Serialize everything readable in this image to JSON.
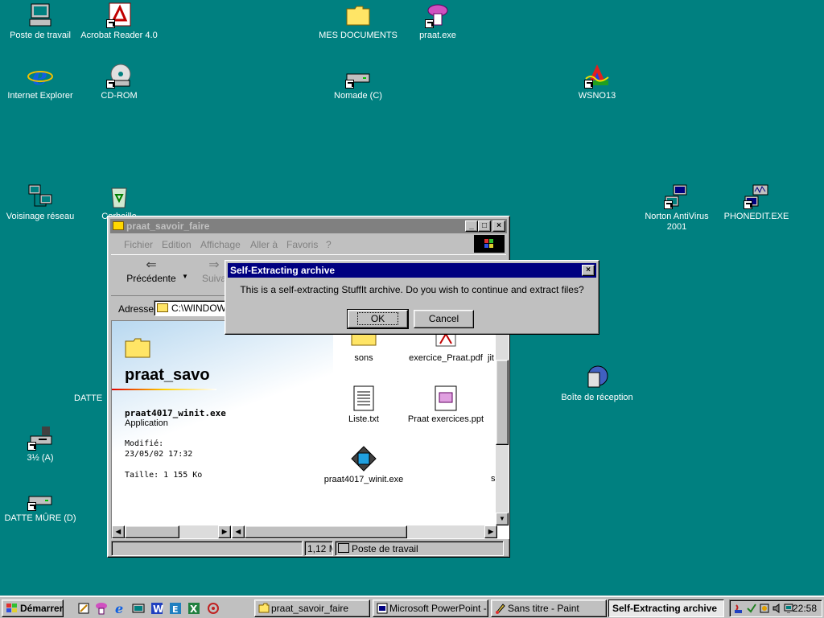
{
  "desktop": {
    "icons": [
      {
        "label": "Poste de travail"
      },
      {
        "label": "Acrobat Reader 4.0"
      },
      {
        "label": "MES DOCUMENTS"
      },
      {
        "label": "praat.exe"
      },
      {
        "label": "Internet Explorer"
      },
      {
        "label": "CD-ROM"
      },
      {
        "label": "Nomade (C)"
      },
      {
        "label": "WSNO13"
      },
      {
        "label": "Voisinage réseau"
      },
      {
        "label": "Corbeille"
      },
      {
        "label": "Norton AntiVirus 2001"
      },
      {
        "label": "PHONEDIT.EXE"
      },
      {
        "label": "Boîte de réception"
      },
      {
        "label": "DATTE"
      },
      {
        "label": "3½ (A)"
      },
      {
        "label": "DATTE MÛRE (D)"
      }
    ]
  },
  "explorer": {
    "title": "praat_savoir_faire",
    "menu": [
      "Fichier",
      "Edition",
      "Affichage",
      "Aller à",
      "Favoris",
      "?"
    ],
    "toolbar": {
      "back_label": "Précédente",
      "forward_label": "Suiva"
    },
    "address": {
      "label": "Adresse",
      "value": "C:\\WINDOWS"
    },
    "info_panel": {
      "folder_name": "praat_savo",
      "file_name": "praat4017_winit.exe",
      "file_type": "Application",
      "modified_label": "Modifié:",
      "modified_value": "23/05/02 17:32",
      "size": "Taille: 1 155 Ko"
    },
    "files": [
      {
        "label": "sons"
      },
      {
        "label": "exercice_Praat.pdf"
      },
      {
        "label": "jit"
      },
      {
        "label": "Liste.txt"
      },
      {
        "label": "Praat exercices.ppt"
      },
      {
        "label": "praat4017_winit.exe"
      },
      {
        "label": "s"
      }
    ],
    "status": {
      "size": "1,12 M",
      "location": "Poste de travail"
    }
  },
  "dialog": {
    "title": "Self-Extracting archive",
    "message": "This is a self-extracting StuffIt archive. Do you wish to continue and extract files?",
    "ok_label": "OK",
    "cancel_label": "Cancel"
  },
  "taskbar": {
    "start_label": "Démarrer",
    "tasks": [
      {
        "label": "praat_savoir_faire"
      },
      {
        "label": "Microsoft PowerPoint - ..."
      },
      {
        "label": "Sans titre - Paint"
      },
      {
        "label": "Self-Extracting archive"
      }
    ],
    "clock": "22:58"
  }
}
